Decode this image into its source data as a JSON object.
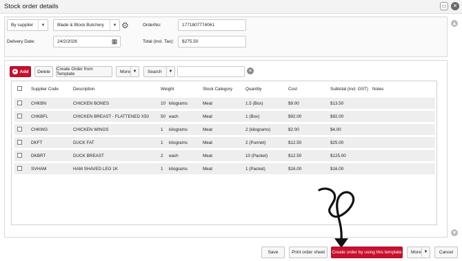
{
  "window": {
    "title": "Stock order details"
  },
  "filters": {
    "mode": "By supplier",
    "supplier": "Blade & Block Butchery",
    "order_no_label": "OrderNo:",
    "order_no": "1771807774061",
    "delivery_date_label": "Delivery Date:",
    "delivery_date": "24/2/2026",
    "total_label": "Total (incl. Tax):",
    "total": "$275.50"
  },
  "toolbar": {
    "add": "Add",
    "delete": "Delete",
    "create_from_template": "Create Order from Template",
    "more": "More",
    "search": "Search",
    "search_value": ""
  },
  "table": {
    "headers": {
      "supplier_code": "Supplier Code",
      "description": "Description",
      "weight": "Weight",
      "stock_category": "Stock Category",
      "quantity": "Quantity",
      "cost": "Cost",
      "subtotal": "Subtotal (incl. GST)",
      "notes": "Notes"
    },
    "rows": [
      {
        "code": "CHKBN",
        "desc": "CHICKEN BONES",
        "wnum": "10",
        "wunit": "kilograms",
        "cat": "Meat",
        "qty": "1.5 (Box)",
        "cost": "$9.00",
        "subtotal": "$13.50"
      },
      {
        "code": "CHKBFL",
        "desc": "CHICKEN BREAST - FLATTENED X50",
        "wnum": "50",
        "wunit": "each",
        "cat": "Meat",
        "qty": "1 (Box)",
        "cost": "$92.00",
        "subtotal": "$92.00"
      },
      {
        "code": "CHKWG",
        "desc": "CHICKEN WINGS",
        "wnum": "1",
        "wunit": "kilograms",
        "cat": "Meat",
        "qty": "2 (kilograms)",
        "cost": "$2.00",
        "subtotal": "$4.00"
      },
      {
        "code": "DKFT",
        "desc": "DUCK FAT",
        "wnum": "1",
        "wunit": "kilograms",
        "cat": "Meat",
        "qty": "2 (Punnet)",
        "cost": "$12.50",
        "subtotal": "$25.00"
      },
      {
        "code": "DKBRT",
        "desc": "DUCK BREAST",
        "wnum": "2",
        "wunit": "each",
        "cat": "Meat",
        "qty": "10 (Packet)",
        "cost": "$12.50",
        "subtotal": "$125.00"
      },
      {
        "code": "SVHAM",
        "desc": "HAM SHAVED LEG 1K",
        "wnum": "1",
        "wunit": "kilograms",
        "cat": "Meat",
        "qty": "1 (Packet)",
        "cost": "$16.00",
        "subtotal": "$16.00"
      }
    ]
  },
  "footer": {
    "save": "Save",
    "print": "Print order sheet",
    "create_template": "Create order by using this template",
    "more": "More",
    "cancel": "Cancel"
  },
  "colors": {
    "accent": "#c8102e"
  }
}
